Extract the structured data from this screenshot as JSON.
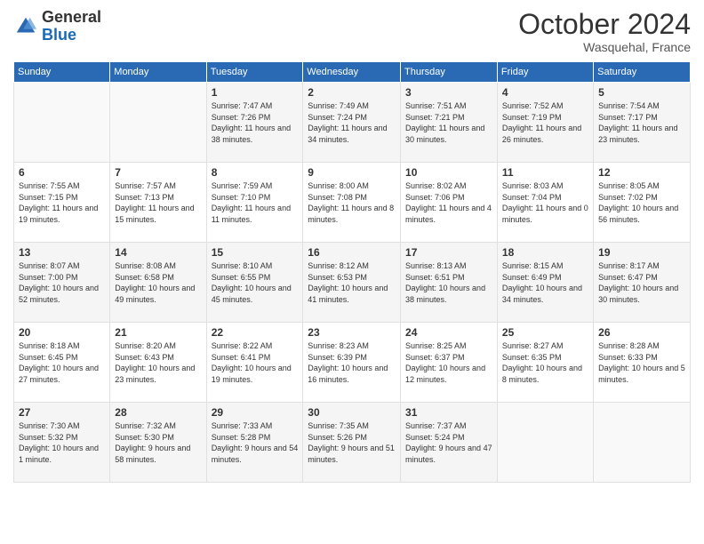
{
  "header": {
    "logo_general": "General",
    "logo_blue": "Blue",
    "month_title": "October 2024",
    "location": "Wasquehal, France"
  },
  "calendar": {
    "days_of_week": [
      "Sunday",
      "Monday",
      "Tuesday",
      "Wednesday",
      "Thursday",
      "Friday",
      "Saturday"
    ],
    "weeks": [
      [
        {
          "day": "",
          "sunrise": "",
          "sunset": "",
          "daylight": ""
        },
        {
          "day": "",
          "sunrise": "",
          "sunset": "",
          "daylight": ""
        },
        {
          "day": "1",
          "sunrise": "Sunrise: 7:47 AM",
          "sunset": "Sunset: 7:26 PM",
          "daylight": "Daylight: 11 hours and 38 minutes."
        },
        {
          "day": "2",
          "sunrise": "Sunrise: 7:49 AM",
          "sunset": "Sunset: 7:24 PM",
          "daylight": "Daylight: 11 hours and 34 minutes."
        },
        {
          "day": "3",
          "sunrise": "Sunrise: 7:51 AM",
          "sunset": "Sunset: 7:21 PM",
          "daylight": "Daylight: 11 hours and 30 minutes."
        },
        {
          "day": "4",
          "sunrise": "Sunrise: 7:52 AM",
          "sunset": "Sunset: 7:19 PM",
          "daylight": "Daylight: 11 hours and 26 minutes."
        },
        {
          "day": "5",
          "sunrise": "Sunrise: 7:54 AM",
          "sunset": "Sunset: 7:17 PM",
          "daylight": "Daylight: 11 hours and 23 minutes."
        }
      ],
      [
        {
          "day": "6",
          "sunrise": "Sunrise: 7:55 AM",
          "sunset": "Sunset: 7:15 PM",
          "daylight": "Daylight: 11 hours and 19 minutes."
        },
        {
          "day": "7",
          "sunrise": "Sunrise: 7:57 AM",
          "sunset": "Sunset: 7:13 PM",
          "daylight": "Daylight: 11 hours and 15 minutes."
        },
        {
          "day": "8",
          "sunrise": "Sunrise: 7:59 AM",
          "sunset": "Sunset: 7:10 PM",
          "daylight": "Daylight: 11 hours and 11 minutes."
        },
        {
          "day": "9",
          "sunrise": "Sunrise: 8:00 AM",
          "sunset": "Sunset: 7:08 PM",
          "daylight": "Daylight: 11 hours and 8 minutes."
        },
        {
          "day": "10",
          "sunrise": "Sunrise: 8:02 AM",
          "sunset": "Sunset: 7:06 PM",
          "daylight": "Daylight: 11 hours and 4 minutes."
        },
        {
          "day": "11",
          "sunrise": "Sunrise: 8:03 AM",
          "sunset": "Sunset: 7:04 PM",
          "daylight": "Daylight: 11 hours and 0 minutes."
        },
        {
          "day": "12",
          "sunrise": "Sunrise: 8:05 AM",
          "sunset": "Sunset: 7:02 PM",
          "daylight": "Daylight: 10 hours and 56 minutes."
        }
      ],
      [
        {
          "day": "13",
          "sunrise": "Sunrise: 8:07 AM",
          "sunset": "Sunset: 7:00 PM",
          "daylight": "Daylight: 10 hours and 52 minutes."
        },
        {
          "day": "14",
          "sunrise": "Sunrise: 8:08 AM",
          "sunset": "Sunset: 6:58 PM",
          "daylight": "Daylight: 10 hours and 49 minutes."
        },
        {
          "day": "15",
          "sunrise": "Sunrise: 8:10 AM",
          "sunset": "Sunset: 6:55 PM",
          "daylight": "Daylight: 10 hours and 45 minutes."
        },
        {
          "day": "16",
          "sunrise": "Sunrise: 8:12 AM",
          "sunset": "Sunset: 6:53 PM",
          "daylight": "Daylight: 10 hours and 41 minutes."
        },
        {
          "day": "17",
          "sunrise": "Sunrise: 8:13 AM",
          "sunset": "Sunset: 6:51 PM",
          "daylight": "Daylight: 10 hours and 38 minutes."
        },
        {
          "day": "18",
          "sunrise": "Sunrise: 8:15 AM",
          "sunset": "Sunset: 6:49 PM",
          "daylight": "Daylight: 10 hours and 34 minutes."
        },
        {
          "day": "19",
          "sunrise": "Sunrise: 8:17 AM",
          "sunset": "Sunset: 6:47 PM",
          "daylight": "Daylight: 10 hours and 30 minutes."
        }
      ],
      [
        {
          "day": "20",
          "sunrise": "Sunrise: 8:18 AM",
          "sunset": "Sunset: 6:45 PM",
          "daylight": "Daylight: 10 hours and 27 minutes."
        },
        {
          "day": "21",
          "sunrise": "Sunrise: 8:20 AM",
          "sunset": "Sunset: 6:43 PM",
          "daylight": "Daylight: 10 hours and 23 minutes."
        },
        {
          "day": "22",
          "sunrise": "Sunrise: 8:22 AM",
          "sunset": "Sunset: 6:41 PM",
          "daylight": "Daylight: 10 hours and 19 minutes."
        },
        {
          "day": "23",
          "sunrise": "Sunrise: 8:23 AM",
          "sunset": "Sunset: 6:39 PM",
          "daylight": "Daylight: 10 hours and 16 minutes."
        },
        {
          "day": "24",
          "sunrise": "Sunrise: 8:25 AM",
          "sunset": "Sunset: 6:37 PM",
          "daylight": "Daylight: 10 hours and 12 minutes."
        },
        {
          "day": "25",
          "sunrise": "Sunrise: 8:27 AM",
          "sunset": "Sunset: 6:35 PM",
          "daylight": "Daylight: 10 hours and 8 minutes."
        },
        {
          "day": "26",
          "sunrise": "Sunrise: 8:28 AM",
          "sunset": "Sunset: 6:33 PM",
          "daylight": "Daylight: 10 hours and 5 minutes."
        }
      ],
      [
        {
          "day": "27",
          "sunrise": "Sunrise: 7:30 AM",
          "sunset": "Sunset: 5:32 PM",
          "daylight": "Daylight: 10 hours and 1 minute."
        },
        {
          "day": "28",
          "sunrise": "Sunrise: 7:32 AM",
          "sunset": "Sunset: 5:30 PM",
          "daylight": "Daylight: 9 hours and 58 minutes."
        },
        {
          "day": "29",
          "sunrise": "Sunrise: 7:33 AM",
          "sunset": "Sunset: 5:28 PM",
          "daylight": "Daylight: 9 hours and 54 minutes."
        },
        {
          "day": "30",
          "sunrise": "Sunrise: 7:35 AM",
          "sunset": "Sunset: 5:26 PM",
          "daylight": "Daylight: 9 hours and 51 minutes."
        },
        {
          "day": "31",
          "sunrise": "Sunrise: 7:37 AM",
          "sunset": "Sunset: 5:24 PM",
          "daylight": "Daylight: 9 hours and 47 minutes."
        },
        {
          "day": "",
          "sunrise": "",
          "sunset": "",
          "daylight": ""
        },
        {
          "day": "",
          "sunrise": "",
          "sunset": "",
          "daylight": ""
        }
      ]
    ]
  }
}
